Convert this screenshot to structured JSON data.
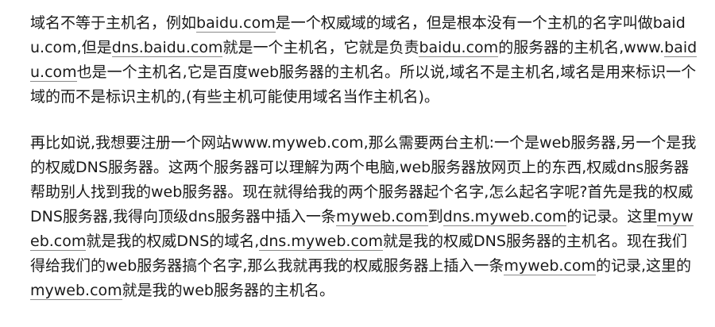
{
  "paragraphs": [
    {
      "segments": [
        {
          "text": "域名不等于主机名，例如"
        },
        {
          "text": "baidu.com",
          "link": true
        },
        {
          "text": "是一个权威域的域名，但是根本没有一个主机的名字叫做baidu.com,但是"
        },
        {
          "text": "dns.baidu.com",
          "link": true
        },
        {
          "text": "就是一个主机名，它就是负责"
        },
        {
          "text": "baidu.com",
          "link": true
        },
        {
          "text": "的服务器的主机名,www."
        },
        {
          "text": "baidu.com",
          "link": true
        },
        {
          "text": "也是一个主机名,它是百度web服务器的主机名。所以说,域名不是主机名,域名是用来标识一个域的而不是标识主机的,(有些主机可能使用域名当作主机名)。"
        }
      ]
    },
    {
      "segments": [
        {
          "text": "再比如说,我想要注册一个网站www.myweb.com,那么需要两台主机:一个是web服务器,另一个是我的权威DNS服务器。这两个服务器可以理解为两个电脑,web服务器放网页上的东西,权威dns服务器帮助别人找到我的web服务器。现在就得给我的两个服务器起个名字,怎么起名字呢?首先是我的权威DNS服务器,我得向顶级dns服务器中插入一条"
        },
        {
          "text": "myweb.com",
          "link": true
        },
        {
          "text": "到"
        },
        {
          "text": "dns.myweb.com",
          "link": true
        },
        {
          "text": "的记录。这里"
        },
        {
          "text": "myweb.com",
          "link": true
        },
        {
          "text": "就是我的权威DNS的域名,"
        },
        {
          "text": "dns.myweb.com",
          "link": true
        },
        {
          "text": "就是我的权威DNS服务器的主机名。现在我们得给我们的web服务器搞个名字,那么我就再我的权威服务器上插入一条"
        },
        {
          "text": "myweb.com",
          "link": true
        },
        {
          "text": "的记录,这里的"
        },
        {
          "text": "myweb.com",
          "link": true
        },
        {
          "text": "就是我的web服务器的主机名。"
        }
      ]
    }
  ]
}
